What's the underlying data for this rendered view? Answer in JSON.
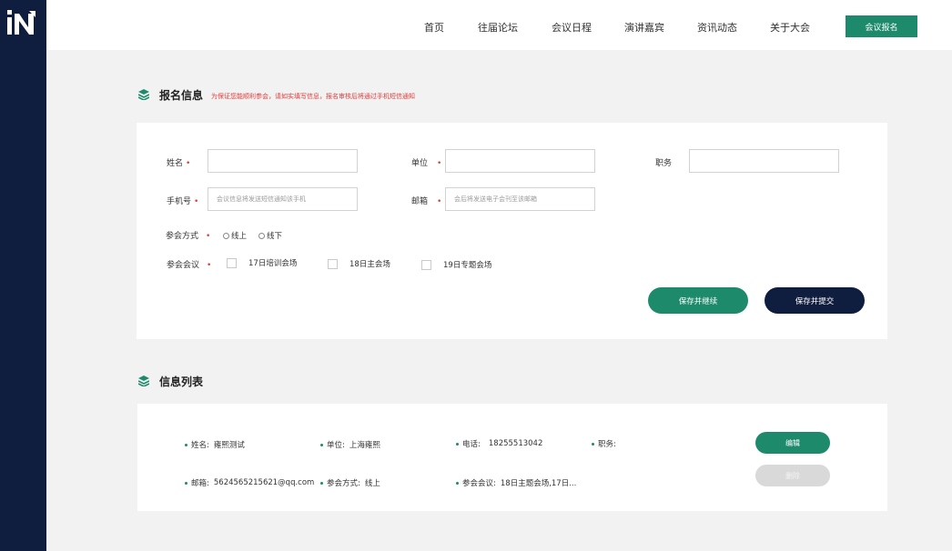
{
  "brand": {
    "logo_text": "iN",
    "accent": "#1d8a6c",
    "navy": "#0f1d3e"
  },
  "nav": {
    "items": [
      "首页",
      "往届论坛",
      "会议日程",
      "演讲嘉宾",
      "资讯动态",
      "关于大会"
    ],
    "cta": "会议报名"
  },
  "form_section": {
    "title": "报名信息",
    "note": "为保证您能顺利参会，请如实填写信息，报名审核后将通过手机短信通知",
    "required_mark": "•",
    "labels": {
      "name": "姓名",
      "company": "单位",
      "position": "职务",
      "phone": "手机号",
      "email": "邮箱",
      "attend_mode": "参会方式",
      "meetings": "参会会议"
    },
    "placeholders": {
      "phone": "会议信息将发送短信通知该手机",
      "email": "会后将发送电子会刊至该邮箱"
    },
    "attend_options": [
      "线上",
      "线下"
    ],
    "meeting_options": [
      "17日培训会场",
      "18日主会场",
      "19日专题会场"
    ],
    "buttons": {
      "save_continue": "保存并继续",
      "save_submit": "保存并提交"
    }
  },
  "list_section": {
    "title": "信息列表",
    "entry": {
      "name_label": "姓名:",
      "name": "雍熙测试",
      "company_label": "单位:",
      "company": "上海雍熙",
      "phone_label": "电话:",
      "phone": "18255513042",
      "position_label": "职务:",
      "email_label": "邮箱:",
      "email": "5624565215621@qq.com",
      "mode_label": "参会方式:",
      "mode": "线上",
      "meetings_label": "参会会议:",
      "meetings": "18日主题会场,17日..."
    },
    "buttons": {
      "edit": "编辑",
      "delete": "删除"
    }
  }
}
